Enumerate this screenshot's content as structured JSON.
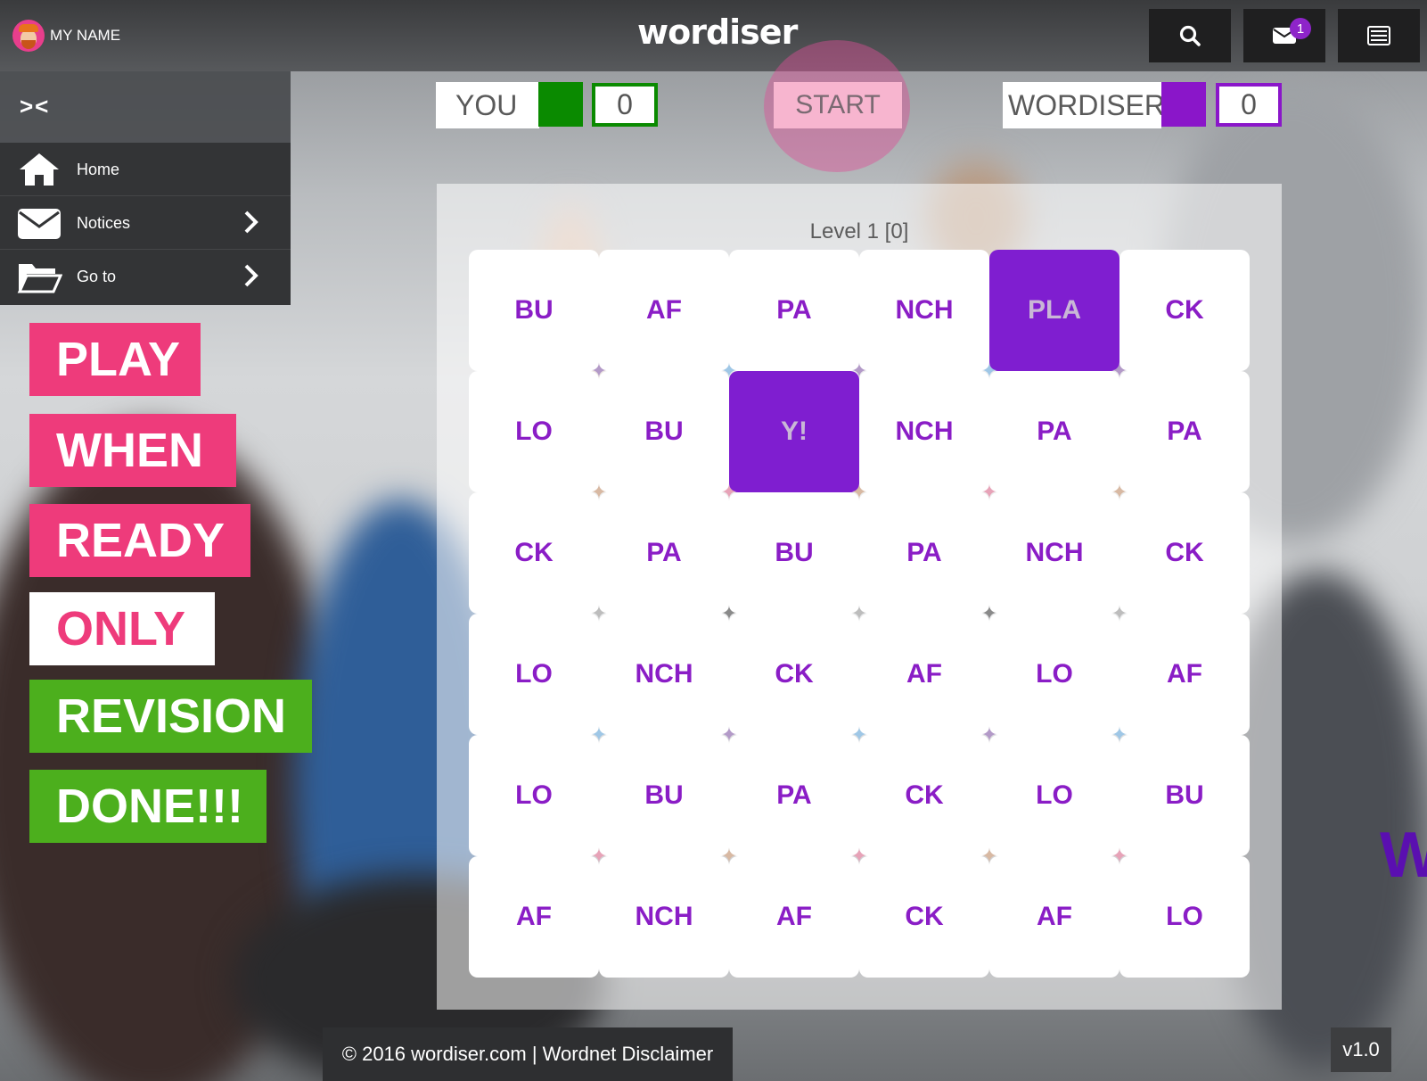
{
  "header": {
    "user_name": "MY NAME",
    "logo_text": "wordiser",
    "mail_badge": "1",
    "icons": [
      "search-icon",
      "mail-icon",
      "list-icon"
    ]
  },
  "sidebar": {
    "collapse_label": "><",
    "items": [
      {
        "label": "Home",
        "icon": "home-icon"
      },
      {
        "label": "Notices",
        "icon": "envelope-icon"
      },
      {
        "label": "Go to",
        "icon": "folder-icon"
      }
    ],
    "tags": [
      {
        "text": "PLAY",
        "bg": "#ee3b7b",
        "fg": "#ffffff"
      },
      {
        "text": "WHEN",
        "bg": "#ee3b7b",
        "fg": "#ffffff"
      },
      {
        "text": "READY",
        "bg": "#ee3b7b",
        "fg": "#ffffff"
      },
      {
        "text": "ONLY",
        "bg": "#ffffff",
        "fg": "#ee3b7b"
      },
      {
        "text": "REVISION",
        "bg": "#4caf1d",
        "fg": "#ffffff"
      },
      {
        "text": "DONE!!!",
        "bg": "#4caf1d",
        "fg": "#ffffff"
      }
    ]
  },
  "scoreboard": {
    "player_label": "YOU",
    "player_score": "0",
    "player_color": "#0a8a00",
    "start_label": "START",
    "opponent_label": "WORDISER",
    "opponent_score": "0",
    "opponent_color": "#8a16c9"
  },
  "board": {
    "level_text": "Level 1 [0]",
    "rows": [
      [
        "BU",
        "AF",
        "PA",
        "NCH",
        "PLA",
        "CK"
      ],
      [
        "LO",
        "BU",
        "Y!",
        "NCH",
        "PA",
        "PA"
      ],
      [
        "CK",
        "PA",
        "BU",
        "PA",
        "NCH",
        "CK"
      ],
      [
        "LO",
        "NCH",
        "CK",
        "AF",
        "LO",
        "AF"
      ],
      [
        "LO",
        "BU",
        "PA",
        "CK",
        "LO",
        "BU"
      ],
      [
        "AF",
        "NCH",
        "AF",
        "CK",
        "AF",
        "LO"
      ]
    ],
    "selected": [
      [
        0,
        4
      ],
      [
        1,
        2
      ]
    ],
    "tile_color": "#8a1dc6",
    "selected_bg": "#7f1ed0"
  },
  "footer": {
    "text": "© 2016 wordiser.com | Wordnet Disclaimer",
    "version": "v1.0",
    "watermark": "W"
  }
}
